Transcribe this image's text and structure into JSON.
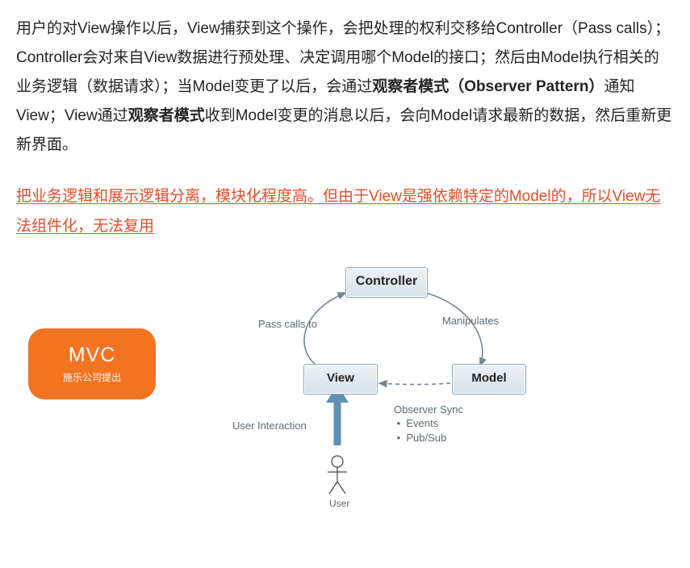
{
  "paragraph": {
    "t1": "用户的对View操作以后，View捕获到这个操作，会把处理的权利交移给Controller（Pass calls）；Controller会对来自View数据进行预处理、决定调用哪个Model的接口；然后由Model执行相关的业务逻辑（数据请求）；当Model变更了以后，会通过",
    "b1": "观察者模式（Observer Pattern）",
    "t2": "通知View；View通过",
    "b2": "观察者模式",
    "t3": "收到Model变更的消息以后，会向Model请求最新的数据，然后重新更新界面。"
  },
  "highlight": "把业务逻辑和展示逻辑分离，模块化程度高。但由于View是强依赖特定的Model的，所以View无法组件化，无法复用",
  "badge": {
    "title": "MVC",
    "subtitle": "施乐公司提出"
  },
  "diagram": {
    "controller": "Controller",
    "view": "View",
    "model": "Model",
    "pass_calls": "Pass calls to",
    "manipulates": "Manipulates",
    "user_interaction": "User Interaction",
    "observer": "Observer Sync",
    "observer_b1": "Events",
    "observer_b2": "Pub/Sub",
    "user": "User"
  }
}
